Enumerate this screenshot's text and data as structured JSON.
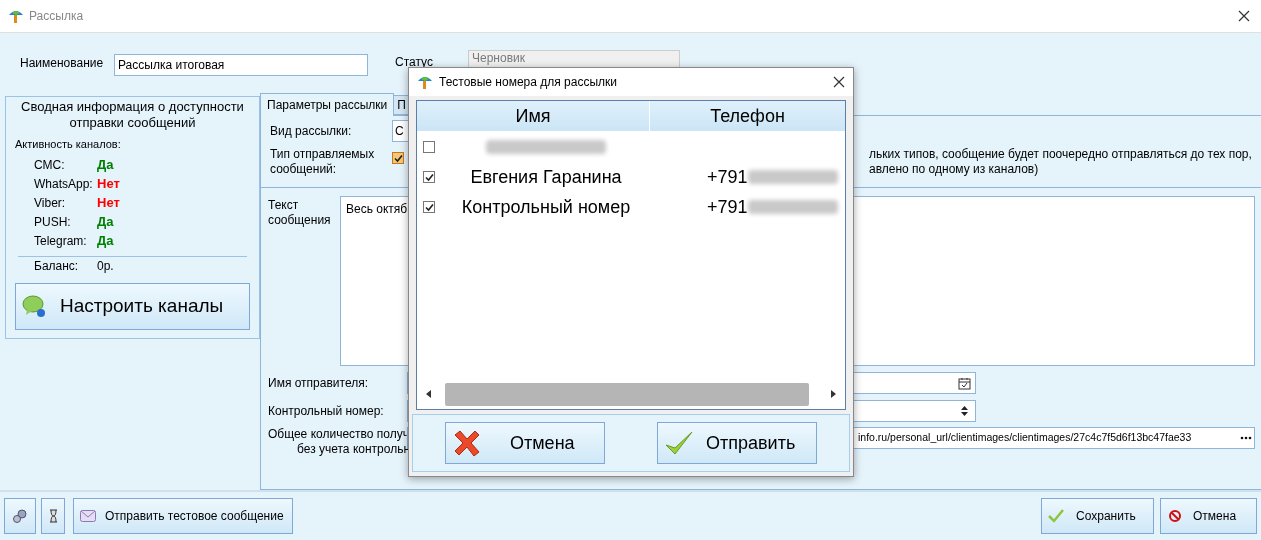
{
  "window": {
    "title": "Рассылка"
  },
  "name_field": {
    "label": "Наименование",
    "value": "Рассылка итоговая"
  },
  "status_field": {
    "label": "Статус",
    "value": "Черновик",
    "disabled": true
  },
  "summary": {
    "title": "Сводная информация о доступности отправки сообщений",
    "channels_label": "Активность каналов:",
    "channels": [
      {
        "name": "СМС:",
        "value": "Да",
        "available": true
      },
      {
        "name": "WhatsApp:",
        "value": "Нет",
        "available": false
      },
      {
        "name": "Viber:",
        "value": "Нет",
        "available": false
      },
      {
        "name": "PUSH:",
        "value": "Да",
        "available": true
      },
      {
        "name": "Telegram:",
        "value": "Да",
        "available": true
      }
    ],
    "balance_label": "Баланс:",
    "balance": "0р.",
    "setup_button": "Настроить каналы"
  },
  "tabs": [
    {
      "label": "Параметры рассылки",
      "selected": true
    },
    {
      "label": "П",
      "selected": false
    }
  ],
  "params": {
    "type_label": "Вид рассылки:",
    "type_value": "С",
    "message_types_label": "Тип отправляемых сообщений:",
    "message_types_checked": true,
    "hint_lines": [
      "льких типов, сообщение будет поочередно отправляться до тех пор,",
      "авлено по одному из каналов)"
    ],
    "text_label": "Текст сообщения",
    "text_value": "Весь октяб",
    "sender_label": "Имя отправителя:",
    "control_label": "Контрольный номер:",
    "total_label_lines": [
      "Общее количество получ",
      "без учета контрольн"
    ],
    "url_value": "info.ru/personal_url/clientimages/clientimages/27c4c7f5d6f13bc47fae33"
  },
  "toolbar": {
    "send_test_button": "Отправить тестовое сообщение",
    "save_button": "Сохранить",
    "cancel_button": "Отмена"
  },
  "dialog": {
    "title": "Тестовые номера для рассылки",
    "columns": [
      "Имя",
      "Телефон"
    ],
    "rows": [
      {
        "checked": false,
        "name_redacted": true
      },
      {
        "checked": true,
        "name": "Евгения Гаранина",
        "phone": "+791",
        "phone_redacted": true
      },
      {
        "checked": true,
        "name": "Контрольный номер",
        "phone": "+791",
        "phone_redacted": true
      }
    ],
    "cancel_button": "Отмена",
    "send_button": "Отправить"
  }
}
